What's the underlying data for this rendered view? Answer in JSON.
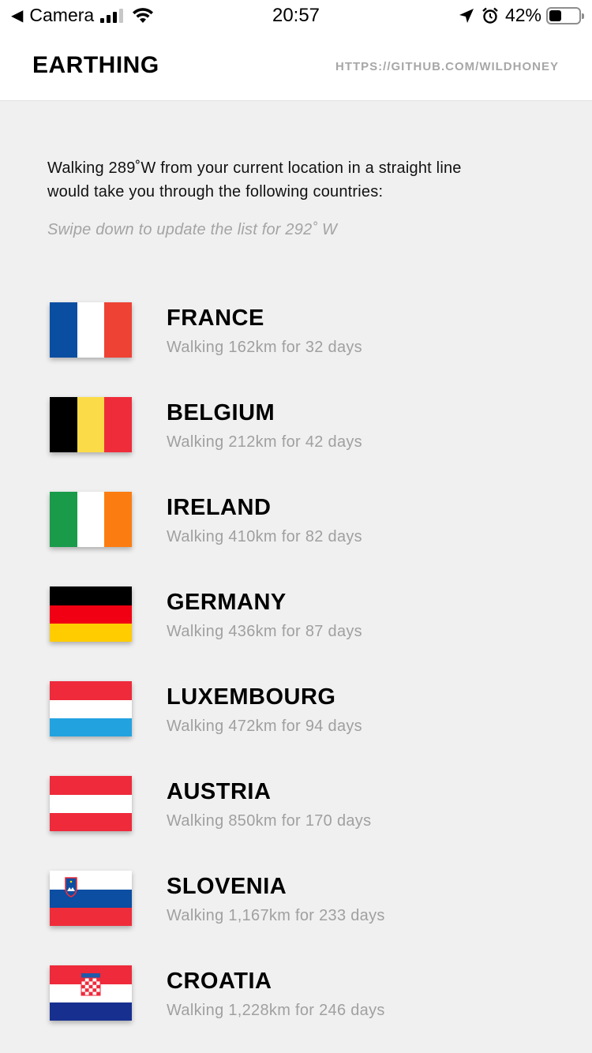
{
  "status_bar": {
    "back_app": "Camera",
    "time": "20:57",
    "battery": "42%",
    "battery_level": 0.42
  },
  "header": {
    "title": "EARTHING",
    "link": "HTTPS://GITHUB.COM/WILDHONEY"
  },
  "intro": {
    "line1": "Walking 289˚W from your current location in a straight line",
    "line2": "would take you through the following countries:",
    "hint": "Swipe down to update the list for 292˚ W"
  },
  "countries": [
    {
      "name": "FRANCE",
      "detail": "Walking 162km for 32 days",
      "flag_icon": "flag-france-icon"
    },
    {
      "name": "BELGIUM",
      "detail": "Walking 212km for 42 days",
      "flag_icon": "flag-belgium-icon"
    },
    {
      "name": "IRELAND",
      "detail": "Walking 410km for 82 days",
      "flag_icon": "flag-ireland-icon"
    },
    {
      "name": "GERMANY",
      "detail": "Walking 436km for 87 days",
      "flag_icon": "flag-germany-icon"
    },
    {
      "name": "LUXEMBOURG",
      "detail": "Walking 472km for 94 days",
      "flag_icon": "flag-luxembourg-icon"
    },
    {
      "name": "AUSTRIA",
      "detail": "Walking 850km for 170 days",
      "flag_icon": "flag-austria-icon"
    },
    {
      "name": "SLOVENIA",
      "detail": "Walking 1,167km for 233 days",
      "flag_icon": "flag-slovenia-icon"
    },
    {
      "name": "CROATIA",
      "detail": "Walking 1,228km for 246 days",
      "flag_icon": "flag-croatia-icon"
    }
  ],
  "colors": {
    "background": "#f0f0f0",
    "header_bg": "#ffffff",
    "link": "#a7a7a7",
    "muted_text": "#a0a0a0"
  }
}
